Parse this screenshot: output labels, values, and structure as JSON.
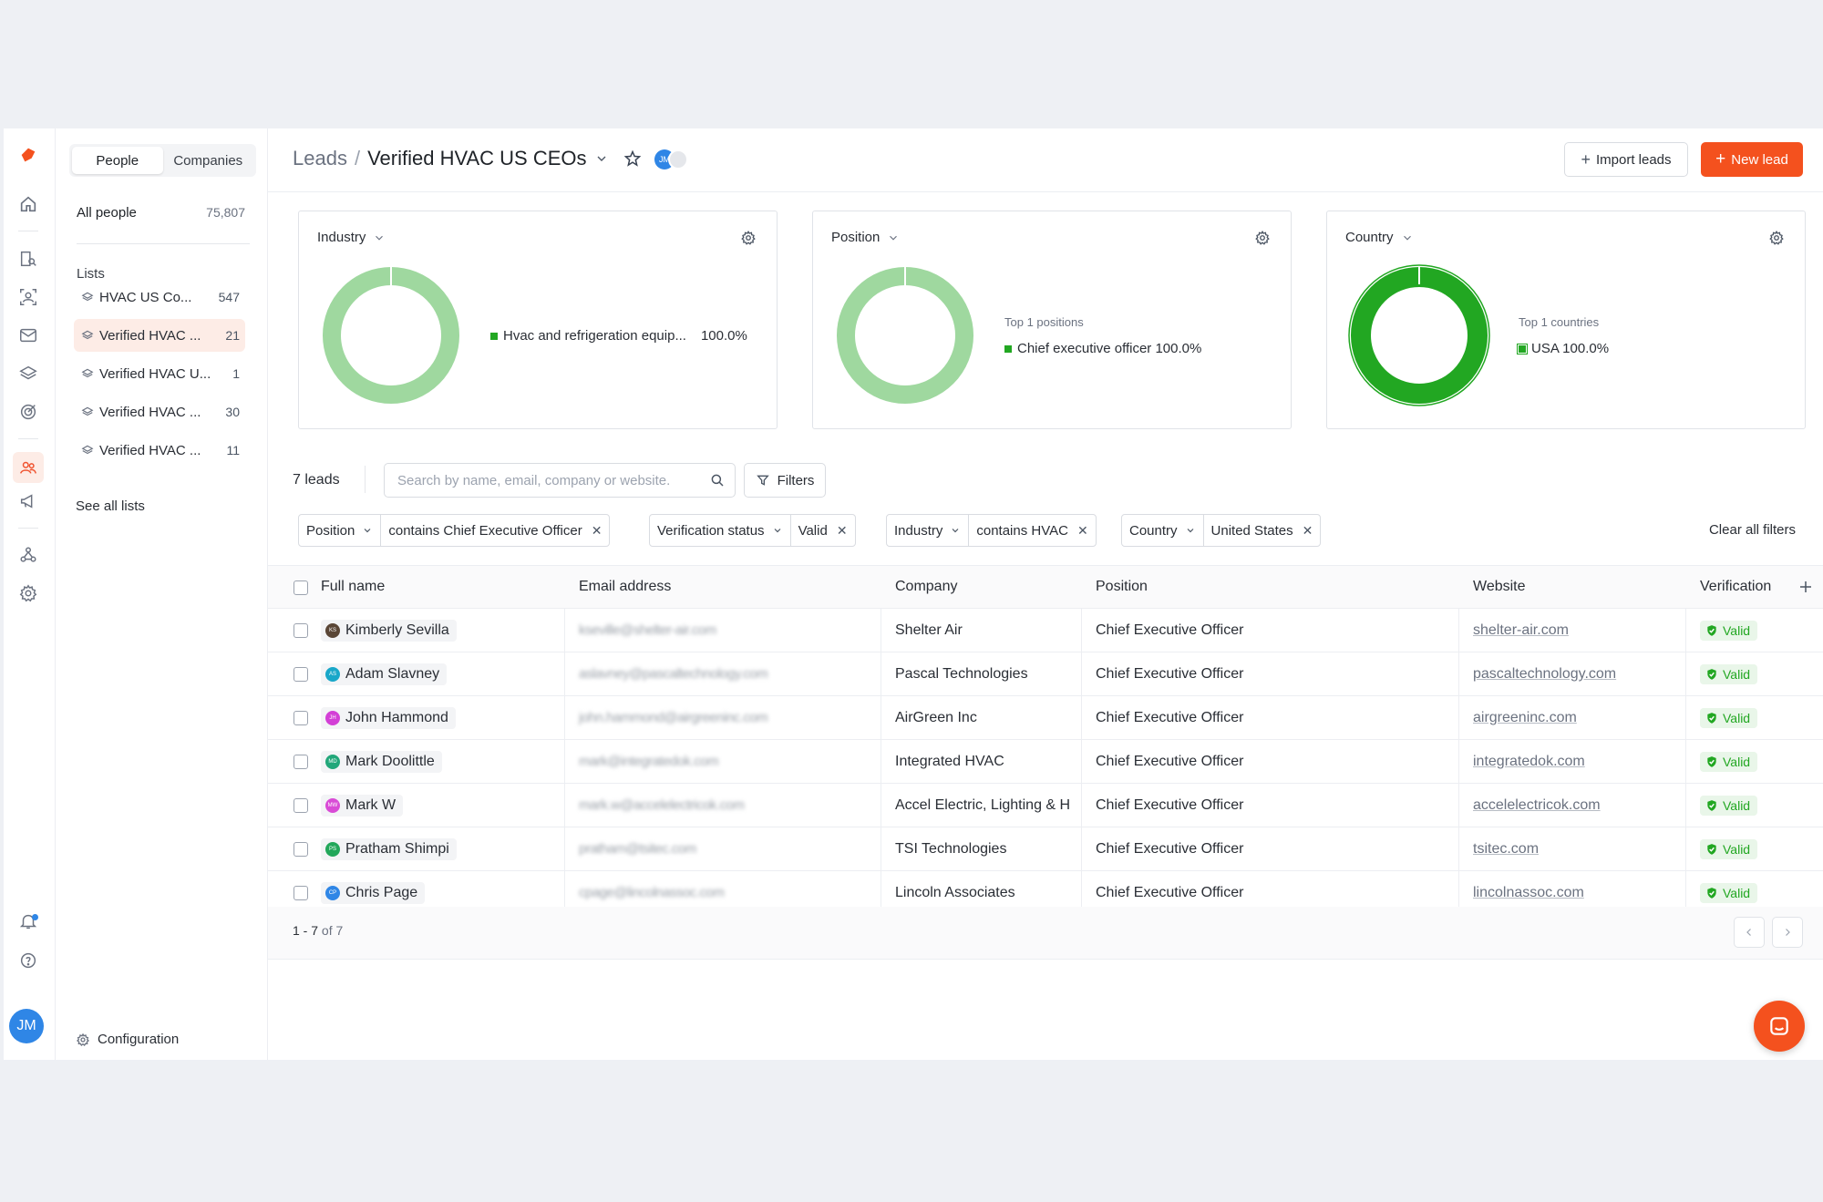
{
  "sidebar": {
    "tabs": [
      "People",
      "Companies"
    ],
    "all_people": {
      "label": "All people",
      "count": "75,807"
    },
    "lists_heading": "Lists",
    "lists": [
      {
        "name": "HVAC US Co...",
        "count": "547"
      },
      {
        "name": "Verified HVAC ...",
        "count": "21"
      },
      {
        "name": "Verified HVAC U...",
        "count": "1"
      },
      {
        "name": "Verified HVAC ...",
        "count": "30"
      },
      {
        "name": "Verified HVAC ...",
        "count": "11"
      }
    ],
    "see_all": "See all lists",
    "configuration": "Configuration"
  },
  "user": {
    "initials": "JM"
  },
  "header": {
    "breadcrumb_root": "Leads",
    "separator": "/",
    "title": "Verified HVAC US CEOs",
    "import_label": "Import leads",
    "new_label": "New lead"
  },
  "cards": {
    "industry": {
      "title": "Industry",
      "legend": "Hvac and refrigeration equip...",
      "value": "100.0%"
    },
    "position": {
      "title": "Position",
      "top_label": "Top 1 positions",
      "legend": "Chief executive officer 100.0%"
    },
    "country": {
      "title": "Country",
      "top_label": "Top 1 countries",
      "legend": "USA 100.0%"
    }
  },
  "toolbar": {
    "count": "7 leads",
    "search_placeholder": "Search by name, email, company or website.",
    "filters_label": "Filters",
    "clear_all": "Clear all filters"
  },
  "chips": [
    {
      "key": "Position",
      "value": "contains Chief Executive Officer"
    },
    {
      "key": "Verification status",
      "value": "Valid"
    },
    {
      "key": "Industry",
      "value": "contains HVAC"
    },
    {
      "key": "Country",
      "value": "United States"
    }
  ],
  "table": {
    "columns": [
      "Full name",
      "Email address",
      "Company",
      "Position",
      "Website",
      "Verification"
    ],
    "rows": [
      {
        "initials": "KS",
        "color": "#5a4636",
        "name": "Kimberly Sevilla",
        "email": "kseville@shelter-air.com",
        "company": "Shelter Air",
        "position": "Chief Executive Officer",
        "website": "shelter-air.com",
        "status": "Valid"
      },
      {
        "initials": "AS",
        "color": "#19a7c9",
        "name": "Adam Slavney",
        "email": "aslavney@pascaltechnology.com",
        "company": "Pascal Technologies",
        "position": "Chief Executive Officer",
        "website": "pascaltechnology.com",
        "status": "Valid"
      },
      {
        "initials": "JH",
        "color": "#d33fd6",
        "name": "John Hammond",
        "email": "john.hammond@airgreeninc.com",
        "company": "AirGreen Inc",
        "position": "Chief Executive Officer",
        "website": "airgreeninc.com",
        "status": "Valid"
      },
      {
        "initials": "MD",
        "color": "#22a77a",
        "name": "Mark Doolittle",
        "email": "mark@integratedok.com",
        "company": "Integrated HVAC",
        "position": "Chief Executive Officer",
        "website": "integratedok.com",
        "status": "Valid"
      },
      {
        "initials": "MW",
        "color": "#d94bd6",
        "name": "Mark W",
        "email": "mark.w@accelelectricok.com",
        "company": "Accel Electric, Lighting & H",
        "position": "Chief Executive Officer",
        "website": "accelelectricok.com",
        "status": "Valid"
      },
      {
        "initials": "PS",
        "color": "#22a75a",
        "name": "Pratham Shimpi",
        "email": "pratham@tsitec.com",
        "company": "TSI Technologies",
        "position": "Chief Executive Officer",
        "website": "tsitec.com",
        "status": "Valid"
      },
      {
        "initials": "CP",
        "color": "#2f86e6",
        "name": "Chris Page",
        "email": "cpage@lincolnassoc.com",
        "company": "Lincoln Associates",
        "position": "Chief Executive Officer",
        "website": "lincolnassoc.com",
        "status": "Valid"
      }
    ]
  },
  "pager": {
    "range": "1 - 7",
    "of": "of 7"
  },
  "colors": {
    "accent": "#f4511e",
    "valid": "#22a722",
    "donut_light": "#9fd89f"
  }
}
